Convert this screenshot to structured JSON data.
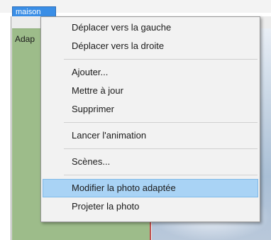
{
  "tab": {
    "label": "maison"
  },
  "panel": {
    "label": "Adap"
  },
  "context_menu": {
    "items": [
      {
        "label": "Déplacer vers la gauche"
      },
      {
        "label": "Déplacer vers la droite"
      },
      {
        "label": "Ajouter..."
      },
      {
        "label": "Mettre à jour"
      },
      {
        "label": "Supprimer"
      },
      {
        "label": "Lancer l'animation"
      },
      {
        "label": "Scènes..."
      },
      {
        "label": "Modifier la photo adaptée"
      },
      {
        "label": "Projeter la photo"
      }
    ],
    "highlighted_index": 7
  },
  "colors": {
    "tab": "#3a8ee6",
    "panel": "#9dbc8a",
    "panel_border": "#c0504d",
    "menu_background": "#f2f2f2",
    "highlight": "#a9d3f5"
  }
}
